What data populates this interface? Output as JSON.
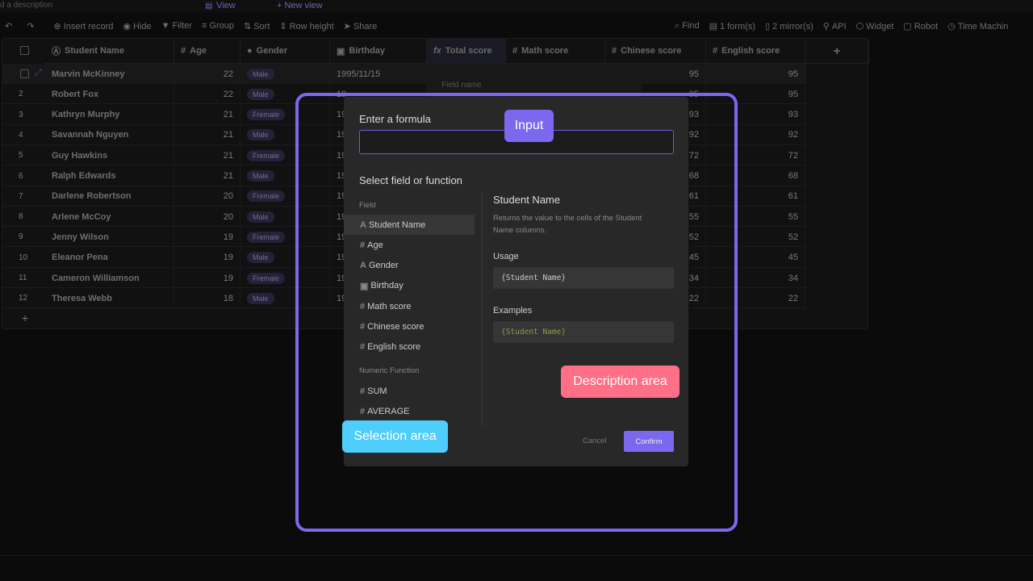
{
  "topbar": {
    "description": "d a description",
    "view": "View",
    "new_view": "+ New view"
  },
  "toolbar": {
    "left": [
      "Insert record",
      "Hide",
      "Filter",
      "Group",
      "Sort",
      "Row height",
      "Share"
    ],
    "right": [
      "Find",
      "1 form(s)",
      "2 mirror(s)",
      "API",
      "Widget",
      "Robot",
      "Time Machin"
    ]
  },
  "columns": [
    "Student Name",
    "Age",
    "Gender",
    "Birthday",
    "Total score",
    "Math score",
    "Chinese score",
    "English score"
  ],
  "column_icons": [
    "text-icon",
    "number-icon",
    "select-icon",
    "calendar-icon",
    "formula-icon",
    "number-icon",
    "number-icon",
    "number-icon"
  ],
  "add_column": "+",
  "add_row": "+",
  "rows": [
    {
      "n": "1",
      "name": "Marvin McKinney",
      "age": "22",
      "gender": "Male",
      "birthday": "1995/11/15",
      "chinese": "95",
      "english": "95"
    },
    {
      "n": "2",
      "name": "Robert Fox",
      "age": "22",
      "gender": "Male",
      "birthday": "19",
      "chinese": "95",
      "english": "95"
    },
    {
      "n": "3",
      "name": "Kathryn Murphy",
      "age": "21",
      "gender": "Fremale",
      "birthday": "19",
      "chinese": "93",
      "english": "93"
    },
    {
      "n": "4",
      "name": "Savannah Nguyen",
      "age": "21",
      "gender": "Male",
      "birthday": "19",
      "chinese": "92",
      "english": "92"
    },
    {
      "n": "5",
      "name": "Guy Hawkins",
      "age": "21",
      "gender": "Fremale",
      "birthday": "19",
      "chinese": "72",
      "english": "72"
    },
    {
      "n": "6",
      "name": "Ralph Edwards",
      "age": "21",
      "gender": "Male",
      "birthday": "19",
      "chinese": "68",
      "english": "68"
    },
    {
      "n": "7",
      "name": "Darlene Robertson",
      "age": "20",
      "gender": "Fremale",
      "birthday": "19",
      "chinese": "61",
      "english": "61"
    },
    {
      "n": "8",
      "name": "Arlene McCoy",
      "age": "20",
      "gender": "Male",
      "birthday": "19",
      "chinese": "55",
      "english": "55"
    },
    {
      "n": "9",
      "name": "Jenny Wilson",
      "age": "19",
      "gender": "Fremale",
      "birthday": "19",
      "chinese": "52",
      "english": "52"
    },
    {
      "n": "10",
      "name": "Eleanor Pena",
      "age": "19",
      "gender": "Male",
      "birthday": "19",
      "chinese": "45",
      "english": "45"
    },
    {
      "n": "11",
      "name": "Cameron Williamson",
      "age": "19",
      "gender": "Fremale",
      "birthday": "19",
      "chinese": "34",
      "english": "34"
    },
    {
      "n": "12",
      "name": "Theresa Webb",
      "age": "18",
      "gender": "Male",
      "birthday": "19",
      "chinese": "22",
      "english": "22"
    }
  ],
  "field_panel": {
    "label": "Field name"
  },
  "modal": {
    "formula_label": "Enter a formula",
    "formula_value": "",
    "select_label": "Select field or function",
    "field_group": "Field",
    "fields": [
      {
        "icon": "A",
        "label": "Student Name"
      },
      {
        "icon": "#",
        "label": "Age"
      },
      {
        "icon": "A",
        "label": "Gender"
      },
      {
        "icon": "▣",
        "label": "Birthday"
      },
      {
        "icon": "#",
        "label": "Math score"
      },
      {
        "icon": "#",
        "label": "Chinese score"
      },
      {
        "icon": "#",
        "label": "English score"
      }
    ],
    "function_group": "Numeric Function",
    "functions": [
      {
        "icon": "#",
        "label": "SUM"
      },
      {
        "icon": "#",
        "label": "AVERAGE"
      }
    ],
    "desc_title": "Student Name",
    "desc_text": "Returns the value to the cells of the Student Name columns.",
    "usage_label": "Usage",
    "usage_code": "{Student Name}",
    "examples_label": "Examples",
    "examples_code": "{Student Name}",
    "cancel": "Cancel",
    "confirm": "Confirm"
  },
  "annotations": {
    "input": "Input",
    "description": "Description area",
    "selection": "Selection area"
  },
  "colors": {
    "accent": "#7b68ee",
    "description_tag": "#ff6f86",
    "selection_tag": "#4fcdfb",
    "code_example": "#8a9a4a"
  }
}
